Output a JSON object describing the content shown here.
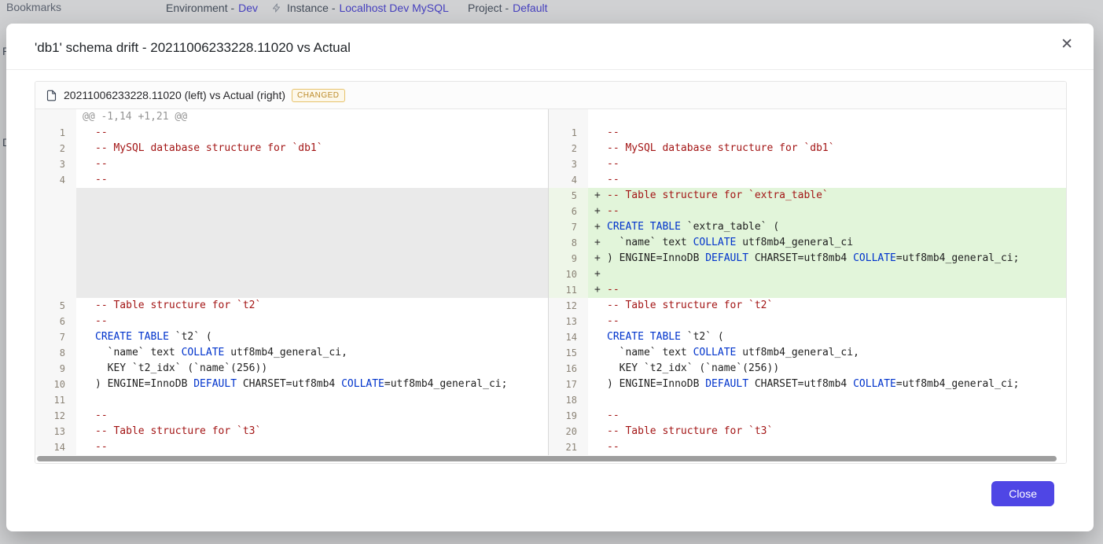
{
  "colors": {
    "accent": "#4f46e5",
    "added_line_bg": "#e2f5da",
    "badge_border": "#e7c26a",
    "badge_text": "#bd8b2a",
    "comment": "#a31515",
    "keyword": "#0033cc"
  },
  "background": {
    "bookmarks": "Bookmarks",
    "sidebar_letters": [
      "P",
      "D"
    ],
    "environment_label": "Environment -",
    "environment_value": "Dev",
    "instance_label": "Instance -",
    "instance_value": "Localhost Dev MySQL",
    "project_label": "Project -",
    "project_value": "Default"
  },
  "modal": {
    "title": "'db1' schema drift - 20211006233228.11020 vs Actual",
    "close_icon": "✕",
    "close_button": "Close"
  },
  "diff": {
    "file_title": "20211006233228.11020 (left) vs Actual (right)",
    "status_badge": "CHANGED",
    "left_lines": [
      {
        "type": "hunk",
        "num": "",
        "segs": [
          {
            "c": "h",
            "t": "@@ -1,14 +1,21 @@"
          }
        ]
      },
      {
        "num": "1",
        "segs": [
          {
            "c": "c",
            "t": "--"
          }
        ]
      },
      {
        "num": "2",
        "segs": [
          {
            "c": "c",
            "t": "-- MySQL database structure for `db1`"
          }
        ]
      },
      {
        "num": "3",
        "segs": [
          {
            "c": "c",
            "t": "--"
          }
        ]
      },
      {
        "num": "4",
        "segs": [
          {
            "c": "c",
            "t": "--"
          }
        ]
      },
      {
        "type": "filler",
        "num": "",
        "segs": []
      },
      {
        "type": "filler",
        "num": "",
        "segs": []
      },
      {
        "type": "filler",
        "num": "",
        "segs": []
      },
      {
        "type": "filler",
        "num": "",
        "segs": []
      },
      {
        "type": "filler",
        "num": "",
        "segs": []
      },
      {
        "type": "filler",
        "num": "",
        "segs": []
      },
      {
        "type": "filler",
        "num": "",
        "segs": []
      },
      {
        "num": "5",
        "segs": [
          {
            "c": "c",
            "t": "-- Table structure for `t2`"
          }
        ]
      },
      {
        "num": "6",
        "segs": [
          {
            "c": "c",
            "t": "--"
          }
        ]
      },
      {
        "num": "7",
        "segs": [
          {
            "c": "k",
            "t": "CREATE TABLE"
          },
          {
            "c": "p",
            "t": " `t2` ("
          }
        ]
      },
      {
        "num": "8",
        "segs": [
          {
            "c": "p",
            "t": "  `name` text "
          },
          {
            "c": "k",
            "t": "COLLATE"
          },
          {
            "c": "p",
            "t": " utf8mb4_general_ci,"
          }
        ]
      },
      {
        "num": "9",
        "segs": [
          {
            "c": "p",
            "t": "  KEY `t2_idx` (`name`(256))"
          }
        ]
      },
      {
        "num": "10",
        "segs": [
          {
            "c": "p",
            "t": ") ENGINE=InnoDB "
          },
          {
            "c": "k",
            "t": "DEFAULT"
          },
          {
            "c": "p",
            "t": " CHARSET=utf8mb4 "
          },
          {
            "c": "k",
            "t": "COLLATE"
          },
          {
            "c": "p",
            "t": "=utf8mb4_general_ci;"
          }
        ]
      },
      {
        "num": "11",
        "segs": []
      },
      {
        "num": "12",
        "segs": [
          {
            "c": "c",
            "t": "--"
          }
        ]
      },
      {
        "num": "13",
        "segs": [
          {
            "c": "c",
            "t": "-- Table structure for `t3`"
          }
        ]
      },
      {
        "num": "14",
        "segs": [
          {
            "c": "c",
            "t": "--"
          }
        ]
      }
    ],
    "right_lines": [
      {
        "type": "hunk",
        "num": "",
        "segs": []
      },
      {
        "num": "1",
        "segs": [
          {
            "c": "c",
            "t": "--"
          }
        ]
      },
      {
        "num": "2",
        "segs": [
          {
            "c": "c",
            "t": "-- MySQL database structure for `db1`"
          }
        ]
      },
      {
        "num": "3",
        "segs": [
          {
            "c": "c",
            "t": "--"
          }
        ]
      },
      {
        "num": "4",
        "segs": [
          {
            "c": "c",
            "t": "--"
          }
        ]
      },
      {
        "num": "5",
        "type": "added",
        "prefix": "+",
        "segs": [
          {
            "c": "c",
            "t": "-- Table structure for `extra_table`"
          }
        ]
      },
      {
        "num": "6",
        "type": "added",
        "prefix": "+",
        "segs": [
          {
            "c": "c",
            "t": "--"
          }
        ]
      },
      {
        "num": "7",
        "type": "added",
        "prefix": "+",
        "segs": [
          {
            "c": "k",
            "t": "CREATE TABLE"
          },
          {
            "c": "p",
            "t": " `extra_table` ("
          }
        ]
      },
      {
        "num": "8",
        "type": "added",
        "prefix": "+",
        "segs": [
          {
            "c": "p",
            "t": "  `name` text "
          },
          {
            "c": "k",
            "t": "COLLATE"
          },
          {
            "c": "p",
            "t": " utf8mb4_general_ci"
          }
        ]
      },
      {
        "num": "9",
        "type": "added",
        "prefix": "+",
        "segs": [
          {
            "c": "p",
            "t": ") ENGINE=InnoDB "
          },
          {
            "c": "k",
            "t": "DEFAULT"
          },
          {
            "c": "p",
            "t": " CHARSET=utf8mb4 "
          },
          {
            "c": "k",
            "t": "COLLATE"
          },
          {
            "c": "p",
            "t": "=utf8mb4_general_ci;"
          }
        ]
      },
      {
        "num": "10",
        "type": "added",
        "prefix": "+",
        "segs": []
      },
      {
        "num": "11",
        "type": "added",
        "prefix": "+",
        "segs": [
          {
            "c": "c",
            "t": "--"
          }
        ]
      },
      {
        "num": "12",
        "segs": [
          {
            "c": "c",
            "t": "-- Table structure for `t2`"
          }
        ]
      },
      {
        "num": "13",
        "segs": [
          {
            "c": "c",
            "t": "--"
          }
        ]
      },
      {
        "num": "14",
        "segs": [
          {
            "c": "k",
            "t": "CREATE TABLE"
          },
          {
            "c": "p",
            "t": " `t2` ("
          }
        ]
      },
      {
        "num": "15",
        "segs": [
          {
            "c": "p",
            "t": "  `name` text "
          },
          {
            "c": "k",
            "t": "COLLATE"
          },
          {
            "c": "p",
            "t": " utf8mb4_general_ci,"
          }
        ]
      },
      {
        "num": "16",
        "segs": [
          {
            "c": "p",
            "t": "  KEY `t2_idx` (`name`(256))"
          }
        ]
      },
      {
        "num": "17",
        "segs": [
          {
            "c": "p",
            "t": ") ENGINE=InnoDB "
          },
          {
            "c": "k",
            "t": "DEFAULT"
          },
          {
            "c": "p",
            "t": " CHARSET=utf8mb4 "
          },
          {
            "c": "k",
            "t": "COLLATE"
          },
          {
            "c": "p",
            "t": "=utf8mb4_general_ci;"
          }
        ]
      },
      {
        "num": "18",
        "segs": []
      },
      {
        "num": "19",
        "segs": [
          {
            "c": "c",
            "t": "--"
          }
        ]
      },
      {
        "num": "20",
        "segs": [
          {
            "c": "c",
            "t": "-- Table structure for `t3`"
          }
        ]
      },
      {
        "num": "21",
        "segs": [
          {
            "c": "c",
            "t": "--"
          }
        ]
      }
    ]
  }
}
